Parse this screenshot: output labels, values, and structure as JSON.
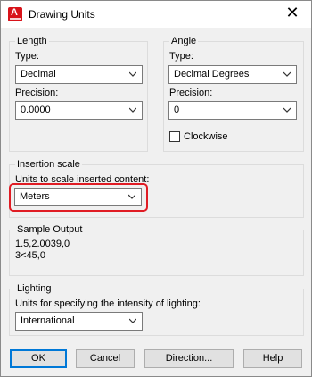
{
  "title_bar": {
    "app_icon": "autocad-icon",
    "title": "Drawing Units",
    "close_glyph": "✕"
  },
  "length": {
    "group_title": "Length",
    "type_label": "Type:",
    "type_value": "Decimal",
    "precision_label": "Precision:",
    "precision_value": "0.0000"
  },
  "angle": {
    "group_title": "Angle",
    "type_label": "Type:",
    "type_value": "Decimal Degrees",
    "precision_label": "Precision:",
    "precision_value": "0",
    "clockwise_label": "Clockwise",
    "clockwise_checked": false
  },
  "insertion": {
    "group_title": "Insertion scale",
    "units_label": "Units to scale inserted content:",
    "units_value": "Meters",
    "highlight_color": "#e01c24"
  },
  "sample": {
    "group_title": "Sample Output",
    "line1": "1.5,2.0039,0",
    "line2": "3<45,0"
  },
  "lighting": {
    "group_title": "Lighting",
    "units_label": "Units for specifying the intensity of lighting:",
    "units_value": "International"
  },
  "buttons": {
    "ok": "OK",
    "cancel": "Cancel",
    "direction": "Direction...",
    "help": "Help"
  },
  "colors": {
    "accent": "#0078d7",
    "dialog_bg": "#f0f0f0",
    "icon_red": "#d8131a"
  }
}
